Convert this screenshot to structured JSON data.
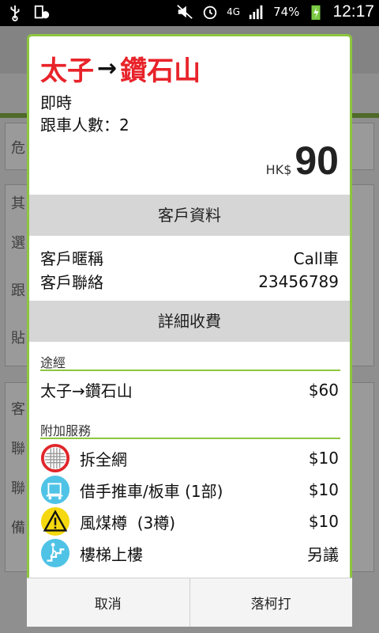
{
  "status_bar": {
    "battery": "74%",
    "network": "4G",
    "time": "12:17"
  },
  "background": {
    "items": [
      "危",
      "其",
      "選",
      "跟",
      "貼",
      "客",
      "聯",
      "聯",
      "備"
    ]
  },
  "dialog": {
    "from": "太子",
    "arrow": "→",
    "to": "鑽石山",
    "timing": "即時",
    "passengers": "跟車人數：2",
    "currency": "HK$",
    "price": "90",
    "customer_section": "客戶資料",
    "customer_name_label": "客戶暱稱",
    "customer_name_value": "Call車",
    "customer_contact_label": "客戶聯絡",
    "customer_contact_value": "23456789",
    "charges_section": "詳細收費",
    "route_label": "途經",
    "route_value": "太子→鑽石山",
    "route_price": "$60",
    "extra_label": "附加服務",
    "services": [
      {
        "icon": "net-removal-icon",
        "label": "拆全網",
        "price": "$10"
      },
      {
        "icon": "trolley-icon",
        "label": "借手推車/板車 (1部)",
        "price": "$10"
      },
      {
        "icon": "warning-icon",
        "label": "風煤樽  (3樽)",
        "price": "$10"
      },
      {
        "icon": "stairs-icon",
        "label": "樓梯上樓",
        "price": "另議"
      }
    ],
    "cancel_label": "取消",
    "confirm_label": "落柯打"
  },
  "colors": {
    "accent_green": "#8dc63f",
    "title_red": "#e8232a"
  }
}
